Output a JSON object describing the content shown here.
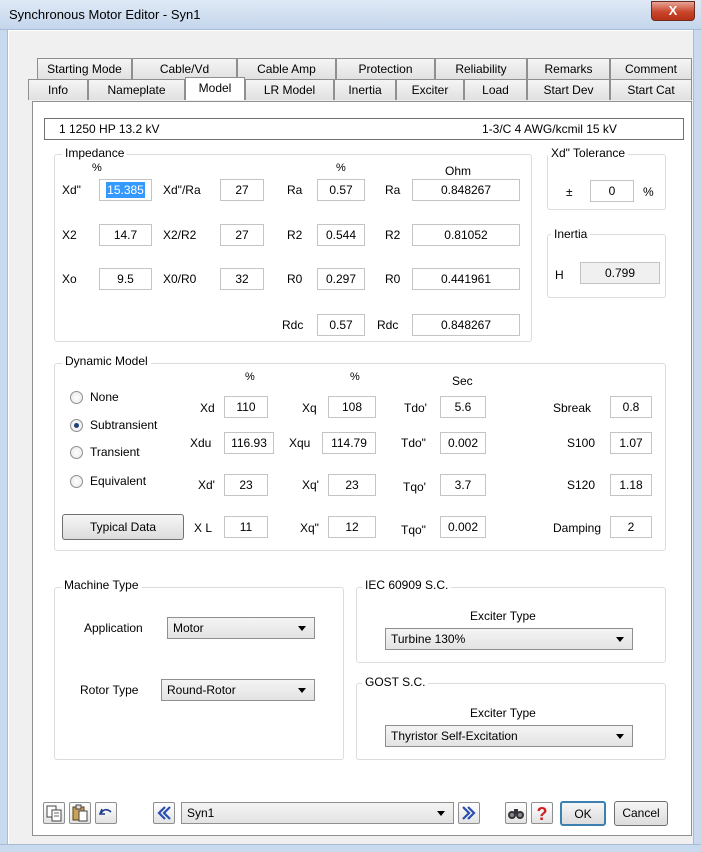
{
  "window": {
    "title": "Synchronous Motor Editor - Syn1",
    "close_label": "X"
  },
  "tabs_row1": [
    "Starting Mode",
    "Cable/Vd",
    "Cable Amp",
    "Protection",
    "Reliability",
    "Remarks",
    "Comment"
  ],
  "tabs_row2": [
    "Info",
    "Nameplate",
    "Model",
    "LR Model",
    "Inertia",
    "Exciter",
    "Load",
    "Start Dev",
    "Start Cat"
  ],
  "active_tab": "Model",
  "header": {
    "left": "1  1250 HP  13.2 kV",
    "right": "1-3/C  4 AWG/kcmil  15 kV"
  },
  "impedance": {
    "title": "Impedance",
    "col_pct1": "%",
    "col_pct2": "%",
    "col_ohm": "Ohm",
    "rows": [
      {
        "l1": "Xd\"",
        "v1": "15.385",
        "l2": "Xd\"/Ra",
        "v2": "27",
        "l3": "Ra",
        "v3": "0.57",
        "l4": "Ra",
        "v4": "0.848267"
      },
      {
        "l1": "X2",
        "v1": "14.7",
        "l2": "X2/R2",
        "v2": "27",
        "l3": "R2",
        "v3": "0.544",
        "l4": "R2",
        "v4": "0.81052"
      },
      {
        "l1": "Xo",
        "v1": "9.5",
        "l2": "X0/R0",
        "v2": "32",
        "l3": "R0",
        "v3": "0.297",
        "l4": "R0",
        "v4": "0.441961"
      }
    ],
    "rdc": {
      "l3": "Rdc",
      "v3": "0.57",
      "l4": "Rdc",
      "v4": "0.848267"
    }
  },
  "tolerance": {
    "title": "Xd\" Tolerance",
    "pm": "±",
    "value": "0",
    "unit": "%"
  },
  "inertia": {
    "title": "Inertia",
    "label": "H",
    "value": "0.799"
  },
  "dynamic": {
    "title": "Dynamic Model",
    "radios": [
      "None",
      "Subtransient",
      "Transient",
      "Equivalent"
    ],
    "selected": "Subtransient",
    "col_pct1": "%",
    "col_pct2": "%",
    "col_sec": "Sec",
    "rows": [
      {
        "l1": "Xd",
        "v1": "110",
        "l2": "Xq",
        "v2": "108",
        "l3": "Tdo'",
        "v3": "5.6",
        "l4": "Sbreak",
        "v4": "0.8"
      },
      {
        "l1": "Xdu",
        "v1": "116.93",
        "l2": "Xqu",
        "v2": "114.79",
        "l3": "Tdo\"",
        "v3": "0.002",
        "l4": "S100",
        "v4": "1.07"
      },
      {
        "l1": "Xd'",
        "v1": "23",
        "l2": "Xq'",
        "v2": "23",
        "l3": "Tqo'",
        "v3": "3.7",
        "l4": "S120",
        "v4": "1.18"
      },
      {
        "l1": "X L",
        "v1": "11",
        "l2": "Xq\"",
        "v2": "12",
        "l3": "Tqo\"",
        "v3": "0.002",
        "l4": "Damping",
        "v4": "2"
      }
    ],
    "typical_button": "Typical Data"
  },
  "machine_type": {
    "title": "Machine Type",
    "application_label": "Application",
    "application_value": "Motor",
    "rotor_label": "Rotor Type",
    "rotor_value": "Round-Rotor"
  },
  "iec": {
    "title": "IEC 60909 S.C.",
    "exciter_label": "Exciter Type",
    "exciter_value": "Turbine 130%"
  },
  "gost": {
    "title": "GOST S.C.",
    "exciter_label": "Exciter Type",
    "exciter_value": "Thyristor Self-Excitation"
  },
  "footer": {
    "nav_value": "Syn1",
    "ok": "OK",
    "cancel": "Cancel"
  },
  "colors": {
    "selection": "#3399ff",
    "help_red": "#d42020",
    "nav_blue": "#2b4fb0"
  }
}
